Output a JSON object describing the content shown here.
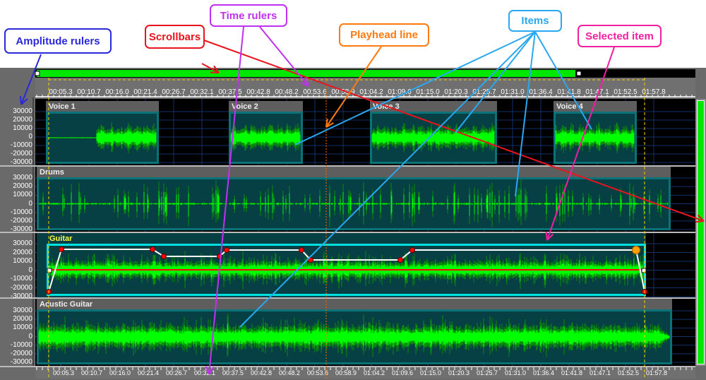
{
  "annotations": {
    "amplitude_rulers": "Amplitude rulers",
    "scrollbars": "Scrollbars",
    "time_rulers": "Time rulers",
    "playhead_line": "Playhead line",
    "items": "Items",
    "selected_item": "Selected item"
  },
  "colors": {
    "waveform": "#00ff00",
    "grid": "#16306a",
    "item_body": "#063f44",
    "selected_border": "#00e0e0",
    "envelope": "#ffffff",
    "envelope_point": "#ff0000",
    "playhead": "#ff6a00",
    "loop_marker": "#ffd000",
    "annot_blue": "#2a2ad8",
    "annot_red": "#e8141e",
    "annot_purple": "#c030f0",
    "annot_orange": "#ff7a10",
    "annot_lightblue": "#2aa8f0",
    "annot_pink": "#f020a0"
  },
  "time_labels": [
    "00:05.3",
    "00:10.7",
    "00:16.0",
    "00:21.4",
    "00:26.7",
    "00:32.1",
    "00:37.5",
    "00:42.8",
    "00:48.2",
    "00:53.6",
    "00:58.9",
    "01:04.2",
    "01:09.6",
    "01:15.0",
    "01:20.3",
    "01:25.7",
    "01:31.0",
    "01:36.4",
    "01:41.8",
    "01:47.1",
    "01:52.5",
    "01:57.8"
  ],
  "amplitude_labels": [
    "30000",
    "20000",
    "10000",
    "0",
    "-10000",
    "-20000",
    "-30000"
  ],
  "tracks": [
    {
      "items": [
        {
          "name": "Voice 1"
        },
        {
          "name": "Voice 2"
        },
        {
          "name": "Voice 3"
        },
        {
          "name": "Voice 4"
        }
      ]
    },
    {
      "items": [
        {
          "name": "Drums"
        }
      ]
    },
    {
      "items": [
        {
          "name": "Guitar",
          "selected": true
        }
      ]
    },
    {
      "items": [
        {
          "name": "Acustic Guitar"
        }
      ]
    }
  ],
  "scrollbars": {
    "horizontal_visible_fraction": 0.82,
    "vertical_visible_fraction": 1.0
  }
}
